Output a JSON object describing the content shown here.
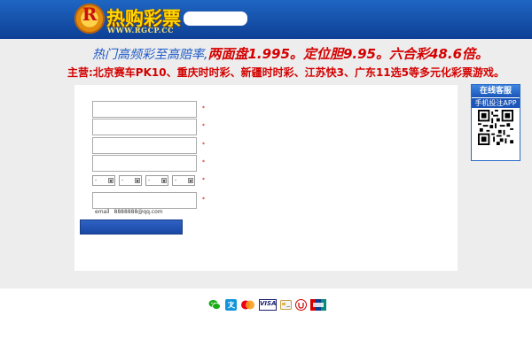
{
  "header": {
    "logo_letter": "R",
    "logo_name": "热购彩票",
    "logo_url": "WWW.RGCP.CC"
  },
  "banner": {
    "line1_prefix": "热门高频彩至高赔率,",
    "line1_items": [
      {
        "label": "两面盘",
        "value": "1.995"
      },
      {
        "label": "定位胆",
        "value": "9.95"
      },
      {
        "label": "六合彩",
        "value": "48.6",
        "suffix": "倍"
      }
    ],
    "line1_separator": "。",
    "line2": "主营:北京赛车PK10、重庆时时彩、新疆时时彩、江苏快3、广东11选5等多元化彩票游戏。"
  },
  "form": {
    "fields": [
      {
        "label": "",
        "value": "",
        "placeholder": "",
        "hint": ""
      },
      {
        "label": "",
        "value": "",
        "placeholder": "",
        "hint": ""
      },
      {
        "label": "",
        "value": "",
        "placeholder": "",
        "hint": ""
      },
      {
        "label": "",
        "value": "",
        "placeholder": "",
        "hint": ""
      }
    ],
    "date_row": {
      "label": "",
      "selects": [
        "-",
        "-",
        "-",
        "-"
      ],
      "hint": ""
    },
    "email_row": {
      "label": "",
      "value": "",
      "placeholder": "",
      "hint": ""
    },
    "email_note_label": "email",
    "email_note_value": "8888888@qq.com",
    "submit_label": ""
  },
  "side_widget": {
    "title": "在线客服",
    "subtitle": "手机投注APP",
    "footer": "",
    "qr_icon": "qr-code-icon"
  },
  "footer": {
    "payments": [
      "wechat-pay-icon",
      "alipay-icon",
      "mastercard-icon",
      "visa-icon",
      "bank-card-icon",
      "unionpay-icon",
      "credit-card-icon"
    ],
    "payment_labels": {
      "visa": "VISA"
    },
    "copyright": ""
  },
  "colors": {
    "header_top": "#1e66c2",
    "header_bottom": "#0e3f96",
    "accent_red": "#d40000",
    "banner_blue": "#1a58c8",
    "button_blue": "#2f62c4"
  }
}
